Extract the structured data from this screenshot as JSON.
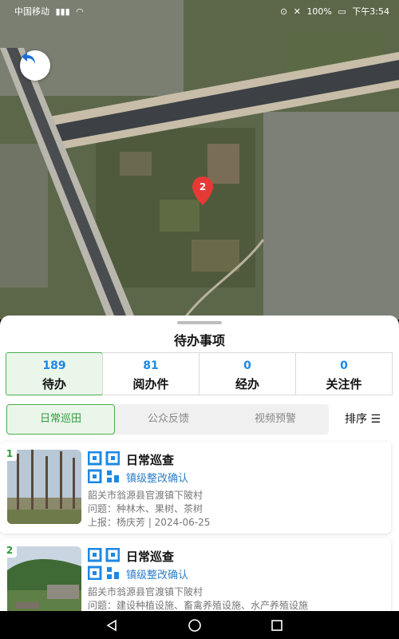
{
  "status_bar": {
    "carrier": "中国移动",
    "battery": "100%",
    "time": "下午3:54"
  },
  "map": {
    "marker_count": "2",
    "back_icon": "undo-arrow-icon"
  },
  "sheet": {
    "title": "待办事项",
    "stats": [
      {
        "count": "189",
        "label": "待办"
      },
      {
        "count": "81",
        "label": "阅办件"
      },
      {
        "count": "0",
        "label": "经办"
      },
      {
        "count": "0",
        "label": "关注件"
      }
    ],
    "tabs": [
      "日常巡田",
      "公众反馈",
      "视频预警"
    ],
    "sort_label": "排序",
    "items": [
      {
        "index": "1",
        "title": "日常巡查",
        "subtitle": "镇级整改确认",
        "address": "韶关市翁源县官渡镇下陂村",
        "issue": "问题：种林木、果树、茶树",
        "report": "上报：杨庆芳 | 2024-06-25"
      },
      {
        "index": "2",
        "title": "日常巡查",
        "subtitle": "镇级整改确认",
        "address": "韶关市翁源县官渡镇下陂村",
        "issue": "问题：建设种植设施、畜禽养殖设施、水产养殖设施"
      }
    ]
  },
  "colors": {
    "accent_green": "#4caf50",
    "accent_blue": "#1e88e5",
    "marker_red": "#e53935"
  }
}
